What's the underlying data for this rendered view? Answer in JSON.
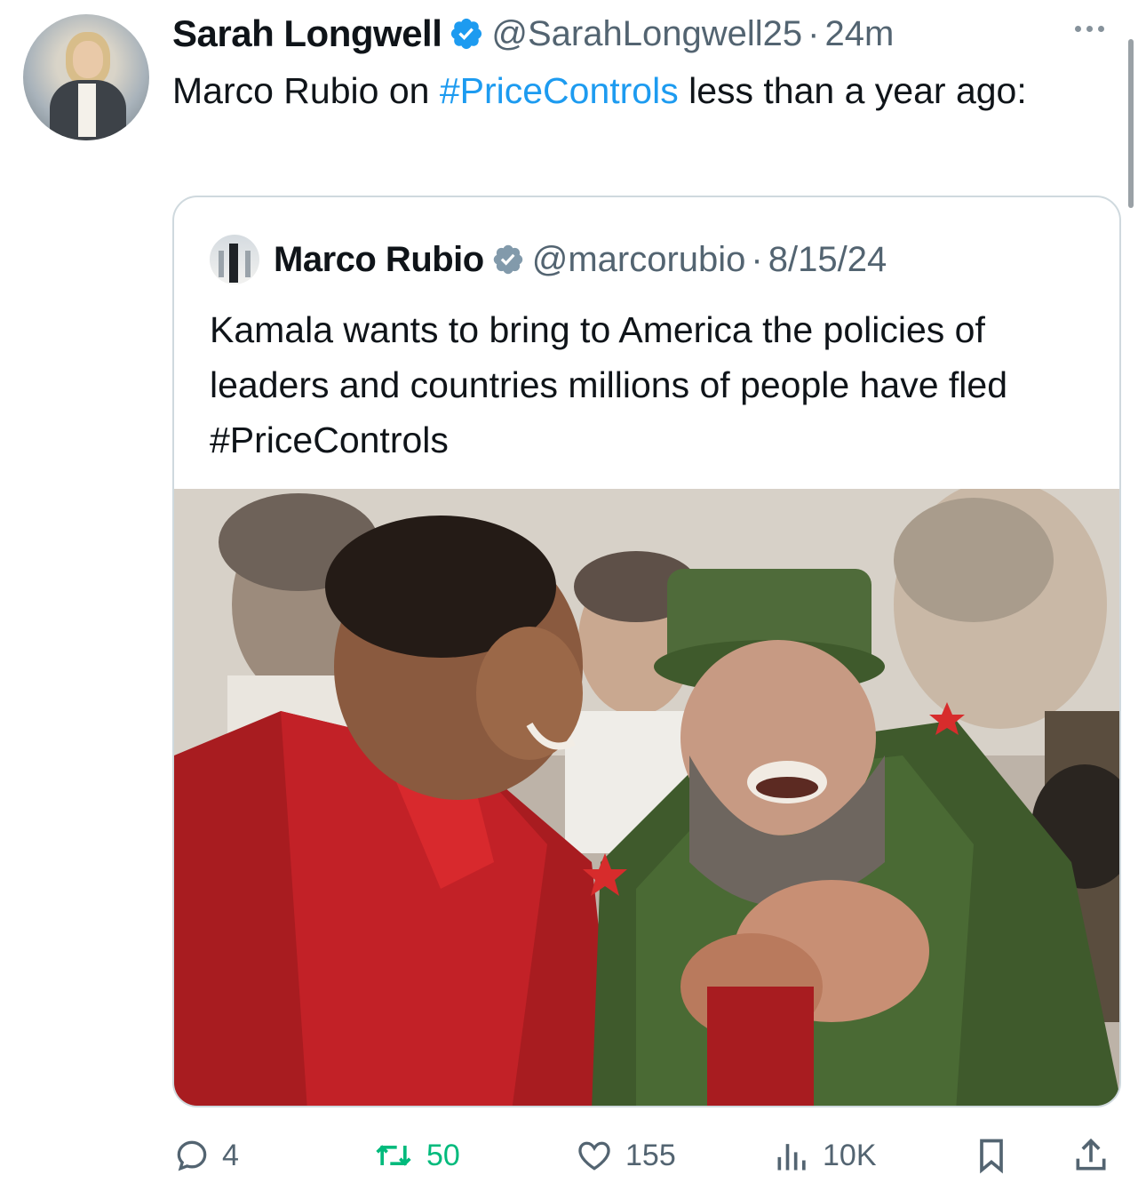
{
  "tweet": {
    "author_name": "Sarah Longwell",
    "handle": "@SarahLongwell25",
    "separator": "·",
    "time": "24m",
    "text_before": "Marco Rubio on ",
    "hashtag": "#PriceControls",
    "text_after": " less than a year ago:"
  },
  "quoted": {
    "author_name": "Marco Rubio",
    "handle": "@marcorubio",
    "separator": "·",
    "date": "8/15/24",
    "text": "Kamala wants to bring to America the policies of leaders and countries millions of people have fled ",
    "hashtag": "#PriceControls"
  },
  "actions": {
    "replies": "4",
    "retweets": "50",
    "likes": "155",
    "views": "10K"
  },
  "colors": {
    "link": "#1d9bf0",
    "secondary": "#536471",
    "retweet": "#00ba7c",
    "verified": "#1d9bf0"
  },
  "icons": [
    "verified-badge-icon",
    "more-icon",
    "reply-icon",
    "retweet-icon",
    "like-icon",
    "views-icon",
    "bookmark-icon",
    "share-icon"
  ]
}
